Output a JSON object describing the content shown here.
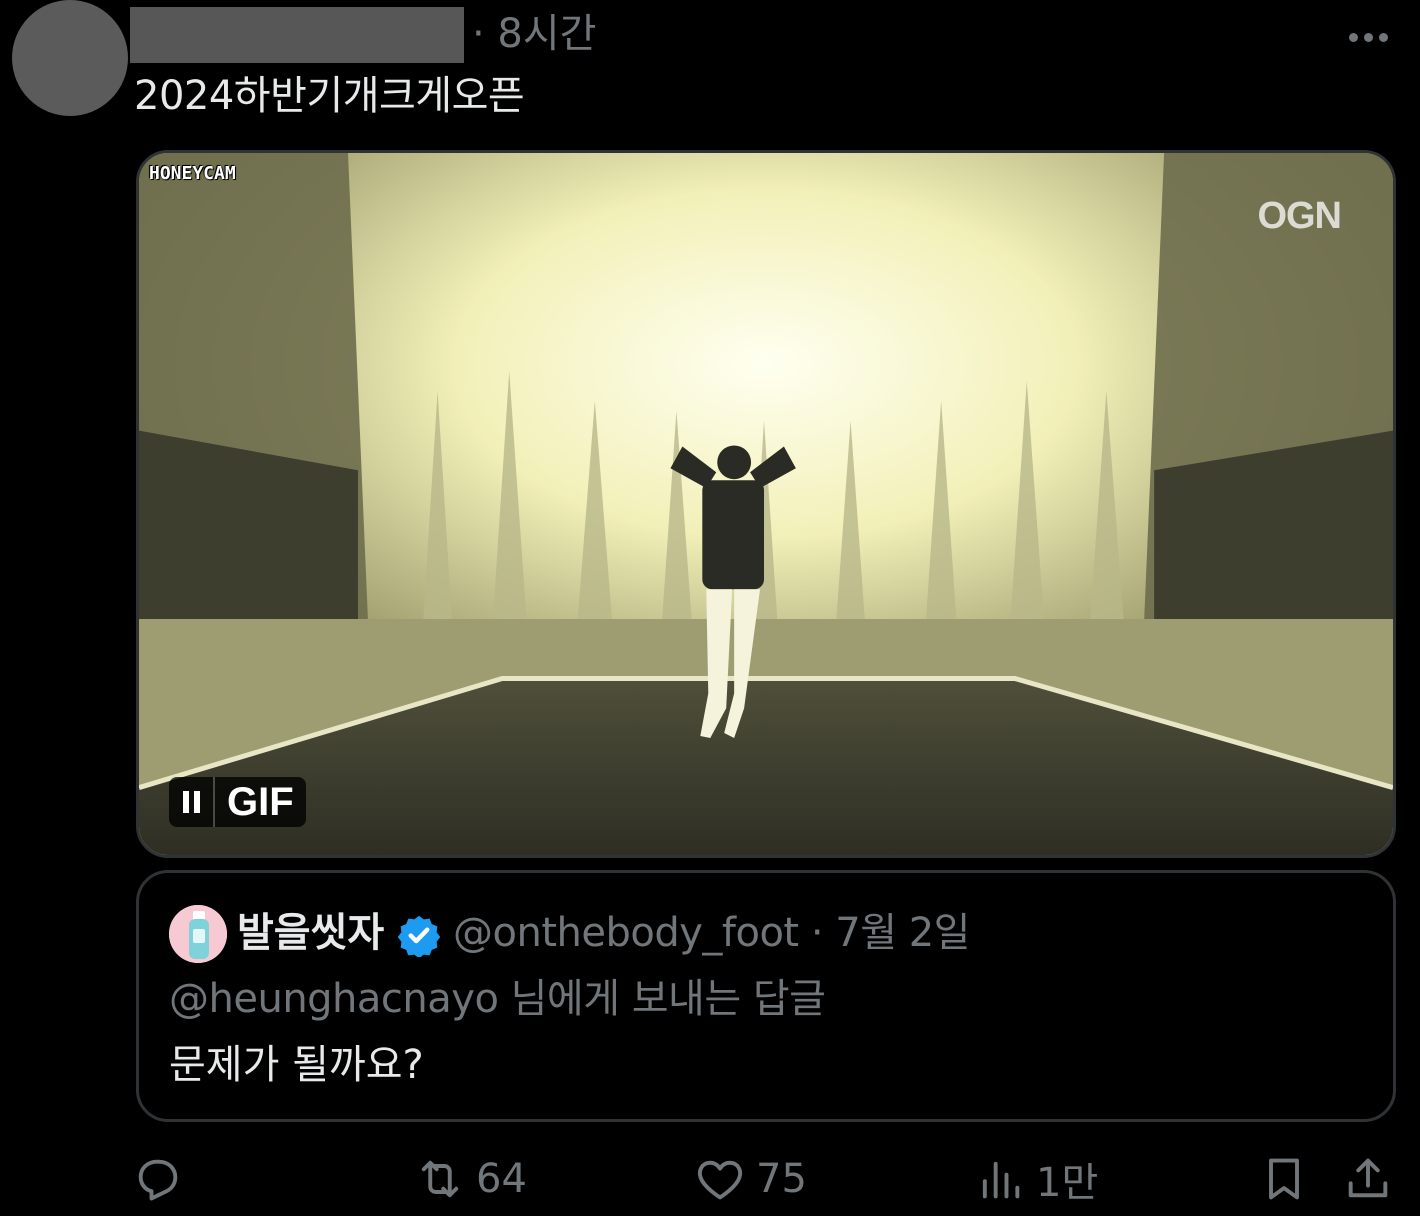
{
  "post": {
    "time": "· 8시간",
    "text": "2024하반기개크게오픈"
  },
  "media": {
    "watermark_left": "HONEYCAM",
    "watermark_right": "OGN",
    "gif_label": "GIF"
  },
  "quote": {
    "name": "발을씻자",
    "handle_date": "@onthebody_foot · 7월 2일",
    "reply_to": "@heunghacnayo 님에게 보내는 답글",
    "text": "문제가 될까요?"
  },
  "actions": {
    "retweets": "64",
    "likes": "75",
    "views": "1만"
  },
  "icons": {
    "more": "more-icon",
    "reply": "reply-icon",
    "retweet": "retweet-icon",
    "like": "heart-icon",
    "views": "views-icon",
    "bookmark": "bookmark-icon",
    "share": "share-icon",
    "verified": "verified-badge-icon"
  },
  "colors": {
    "background": "#000000",
    "text": "#e7e9ea",
    "secondary": "#71767b",
    "border": "#2f3336",
    "verified": "#1d9bf0"
  }
}
